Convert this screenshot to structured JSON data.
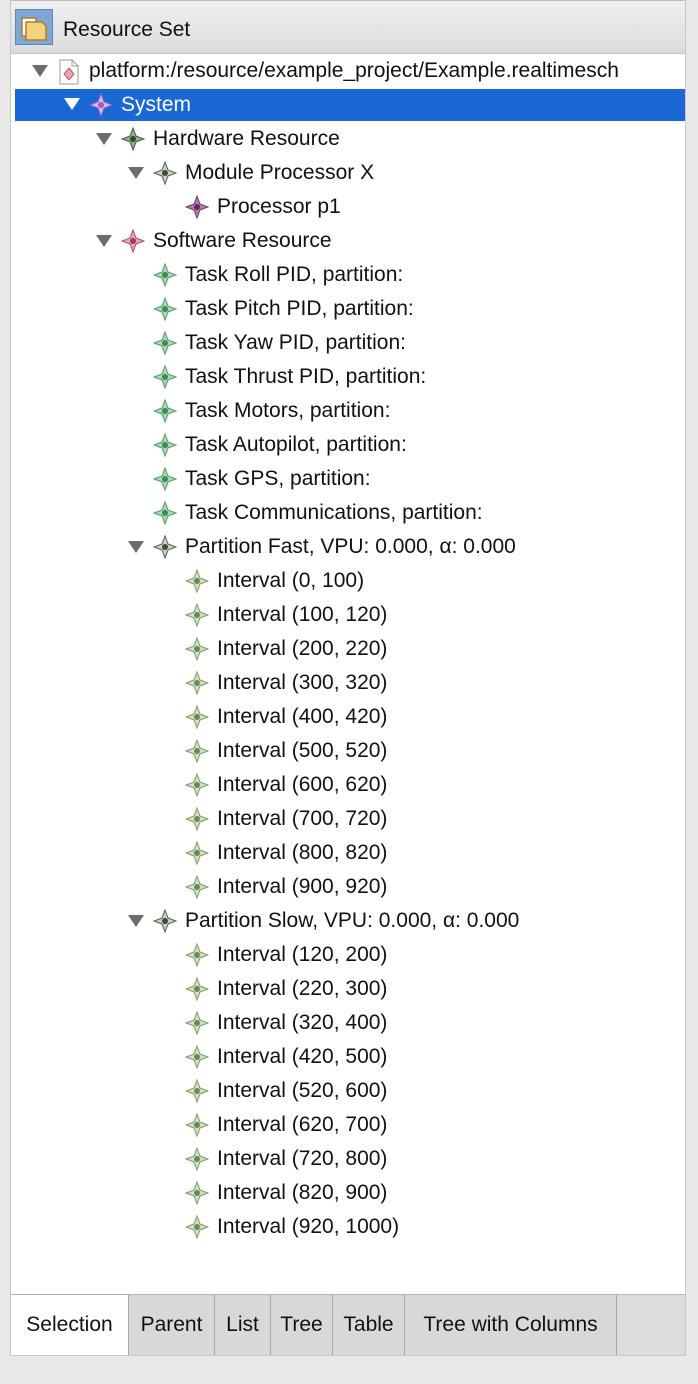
{
  "header": {
    "title": "Resource Set"
  },
  "tree": {
    "rows": [
      {
        "label": "platform:/resource/example_project/Example.realtimesch"
      },
      {
        "label": "System"
      },
      {
        "label": "Hardware Resource"
      },
      {
        "label": "Module Processor X"
      },
      {
        "label": "Processor p1"
      },
      {
        "label": "Software Resource"
      },
      {
        "label": "Task Roll PID, partition:"
      },
      {
        "label": "Task Pitch PID, partition:"
      },
      {
        "label": "Task Yaw PID, partition:"
      },
      {
        "label": "Task Thrust PID, partition:"
      },
      {
        "label": "Task Motors, partition:"
      },
      {
        "label": "Task Autopilot, partition:"
      },
      {
        "label": "Task GPS, partition:"
      },
      {
        "label": "Task Communications, partition:"
      },
      {
        "label": "Partition Fast, VPU: 0.000, α: 0.000"
      },
      {
        "label": "Interval (0, 100)"
      },
      {
        "label": "Interval (100, 120)"
      },
      {
        "label": "Interval (200, 220)"
      },
      {
        "label": "Interval (300, 320)"
      },
      {
        "label": "Interval (400, 420)"
      },
      {
        "label": "Interval (500, 520)"
      },
      {
        "label": "Interval (600, 620)"
      },
      {
        "label": "Interval (700, 720)"
      },
      {
        "label": "Interval (800, 820)"
      },
      {
        "label": "Interval (900, 920)"
      },
      {
        "label": "Partition Slow, VPU: 0.000, α: 0.000"
      },
      {
        "label": "Interval (120, 200)"
      },
      {
        "label": "Interval (220, 300)"
      },
      {
        "label": "Interval (320, 400)"
      },
      {
        "label": "Interval (420, 500)"
      },
      {
        "label": "Interval (520, 600)"
      },
      {
        "label": "Interval (620, 700)"
      },
      {
        "label": "Interval (720, 800)"
      },
      {
        "label": "Interval (820, 900)"
      },
      {
        "label": "Interval (920, 1000)"
      }
    ]
  },
  "tabs": [
    {
      "label": "Selection"
    },
    {
      "label": "Parent"
    },
    {
      "label": "List"
    },
    {
      "label": "Tree"
    },
    {
      "label": "Table"
    },
    {
      "label": "Tree with Columns"
    }
  ],
  "colors": {
    "selection": "#1a68d4",
    "task_icon": "#6fae7e",
    "interval_icon": "#9dbf8a",
    "processor_icon": "#9a4f8e",
    "software_icon": "#c2607e",
    "system_icon": "#c9a0d8"
  }
}
